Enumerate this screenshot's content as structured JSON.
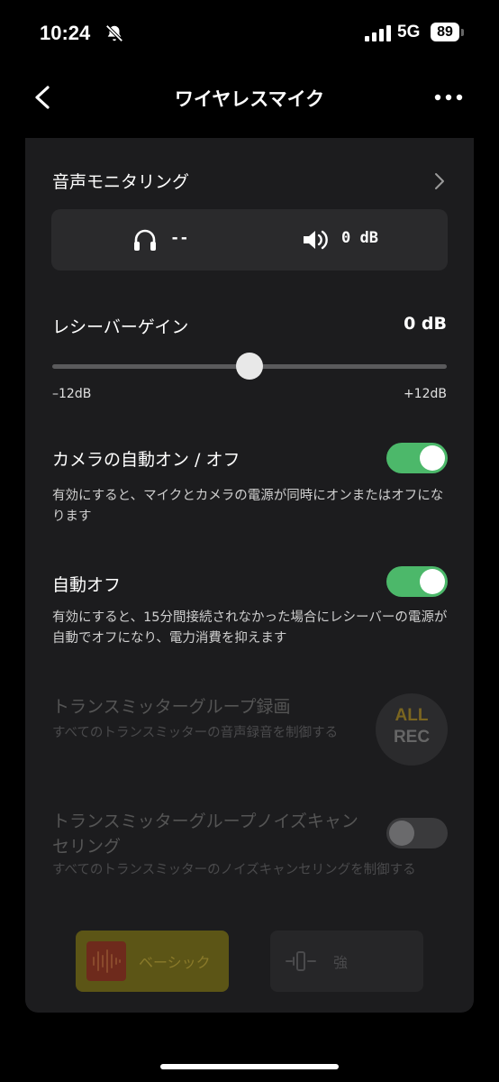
{
  "status_bar": {
    "time": "10:24",
    "bell_icon": "bell-slash-icon",
    "signal_icon": "cellular-signal-icon",
    "network": "5G",
    "battery": "89"
  },
  "nav": {
    "back_icon": "chevron-left-icon",
    "title": "ワイヤレスマイク",
    "more_icon": "more-horizontal-icon"
  },
  "monitoring": {
    "label": "音声モニタリング",
    "headphone_value": "--",
    "speaker_value": "0 dB"
  },
  "gain": {
    "label": "レシーバーゲイン",
    "value": "0 dB",
    "min_label": "–12dB",
    "max_label": "+12dB",
    "min": -12,
    "max": 12,
    "current": 0
  },
  "camera_auto": {
    "label": "カメラの自動オン / オフ",
    "enabled": true,
    "description": "有効にすると、マイクとカメラの電源が同時にオンまたはオフになります"
  },
  "auto_off": {
    "label": "自動オフ",
    "enabled": true,
    "description": "有効にすると、15分間接続されなかった場合にレシーバーの電源が自動でオフになり、電力消費を抑えます"
  },
  "group_record": {
    "label": "トランスミッターグループ録画",
    "description": "すべてのトランスミッターの音声録音を制御する",
    "button_line1": "ALL",
    "button_line2": "REC"
  },
  "group_noise": {
    "label": "トランスミッターグループノイズキャンセリング",
    "enabled": false,
    "description": "すべてのトランスミッターのノイズキャンセリングを制御する"
  },
  "noise_modes": [
    {
      "label": "ベーシック",
      "selected": true
    },
    {
      "label": "強",
      "selected": false
    }
  ],
  "colors": {
    "accent_green": "#4cb86a",
    "accent_yellow": "#c9a928",
    "background": "#000000",
    "card": "#1c1c1e"
  }
}
